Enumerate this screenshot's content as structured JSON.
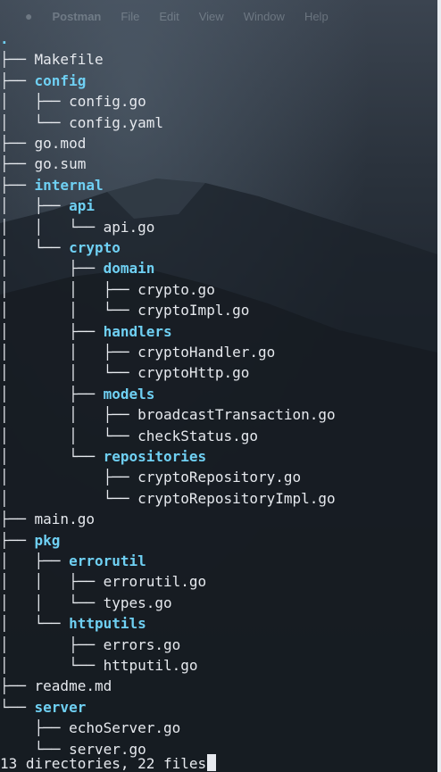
{
  "menubar": {
    "apple": "",
    "app": "Postman",
    "items": [
      "File",
      "Edit",
      "View",
      "Window",
      "Help"
    ]
  },
  "tree": [
    {
      "prefix": "",
      "name": ".",
      "type": "dir"
    },
    {
      "prefix": "├── ",
      "name": "Makefile",
      "type": "file"
    },
    {
      "prefix": "├── ",
      "name": "config",
      "type": "dir"
    },
    {
      "prefix": "│   ├── ",
      "name": "config.go",
      "type": "file"
    },
    {
      "prefix": "│   └── ",
      "name": "config.yaml",
      "type": "file"
    },
    {
      "prefix": "├── ",
      "name": "go.mod",
      "type": "file"
    },
    {
      "prefix": "├── ",
      "name": "go.sum",
      "type": "file"
    },
    {
      "prefix": "├── ",
      "name": "internal",
      "type": "dir"
    },
    {
      "prefix": "│   ├── ",
      "name": "api",
      "type": "dir"
    },
    {
      "prefix": "│   │   └── ",
      "name": "api.go",
      "type": "file"
    },
    {
      "prefix": "│   └── ",
      "name": "crypto",
      "type": "dir"
    },
    {
      "prefix": "│       ├── ",
      "name": "domain",
      "type": "dir"
    },
    {
      "prefix": "│       │   ├── ",
      "name": "crypto.go",
      "type": "file"
    },
    {
      "prefix": "│       │   └── ",
      "name": "cryptoImpl.go",
      "type": "file"
    },
    {
      "prefix": "│       ├── ",
      "name": "handlers",
      "type": "dir"
    },
    {
      "prefix": "│       │   ├── ",
      "name": "cryptoHandler.go",
      "type": "file"
    },
    {
      "prefix": "│       │   └── ",
      "name": "cryptoHttp.go",
      "type": "file"
    },
    {
      "prefix": "│       ├── ",
      "name": "models",
      "type": "dir"
    },
    {
      "prefix": "│       │   ├── ",
      "name": "broadcastTransaction.go",
      "type": "file"
    },
    {
      "prefix": "│       │   └── ",
      "name": "checkStatus.go",
      "type": "file"
    },
    {
      "prefix": "│       └── ",
      "name": "repositories",
      "type": "dir"
    },
    {
      "prefix": "│           ├── ",
      "name": "cryptoRepository.go",
      "type": "file"
    },
    {
      "prefix": "│           └── ",
      "name": "cryptoRepositoryImpl.go",
      "type": "file"
    },
    {
      "prefix": "├── ",
      "name": "main.go",
      "type": "file"
    },
    {
      "prefix": "├── ",
      "name": "pkg",
      "type": "dir"
    },
    {
      "prefix": "│   ├── ",
      "name": "errorutil",
      "type": "dir"
    },
    {
      "prefix": "│   │   ├── ",
      "name": "errorutil.go",
      "type": "file"
    },
    {
      "prefix": "│   │   └── ",
      "name": "types.go",
      "type": "file"
    },
    {
      "prefix": "│   └── ",
      "name": "httputils",
      "type": "dir"
    },
    {
      "prefix": "│       ├── ",
      "name": "errors.go",
      "type": "file"
    },
    {
      "prefix": "│       └── ",
      "name": "httputil.go",
      "type": "file"
    },
    {
      "prefix": "├── ",
      "name": "readme.md",
      "type": "file"
    },
    {
      "prefix": "└── ",
      "name": "server",
      "type": "dir"
    },
    {
      "prefix": "    ├── ",
      "name": "echoServer.go",
      "type": "file"
    },
    {
      "prefix": "    └── ",
      "name": "server.go",
      "type": "file"
    }
  ],
  "summary": "13 directories, 22 files",
  "colors": {
    "directory": "#6fd0f3",
    "file": "#e6e9ee",
    "background": "#1d242d"
  }
}
